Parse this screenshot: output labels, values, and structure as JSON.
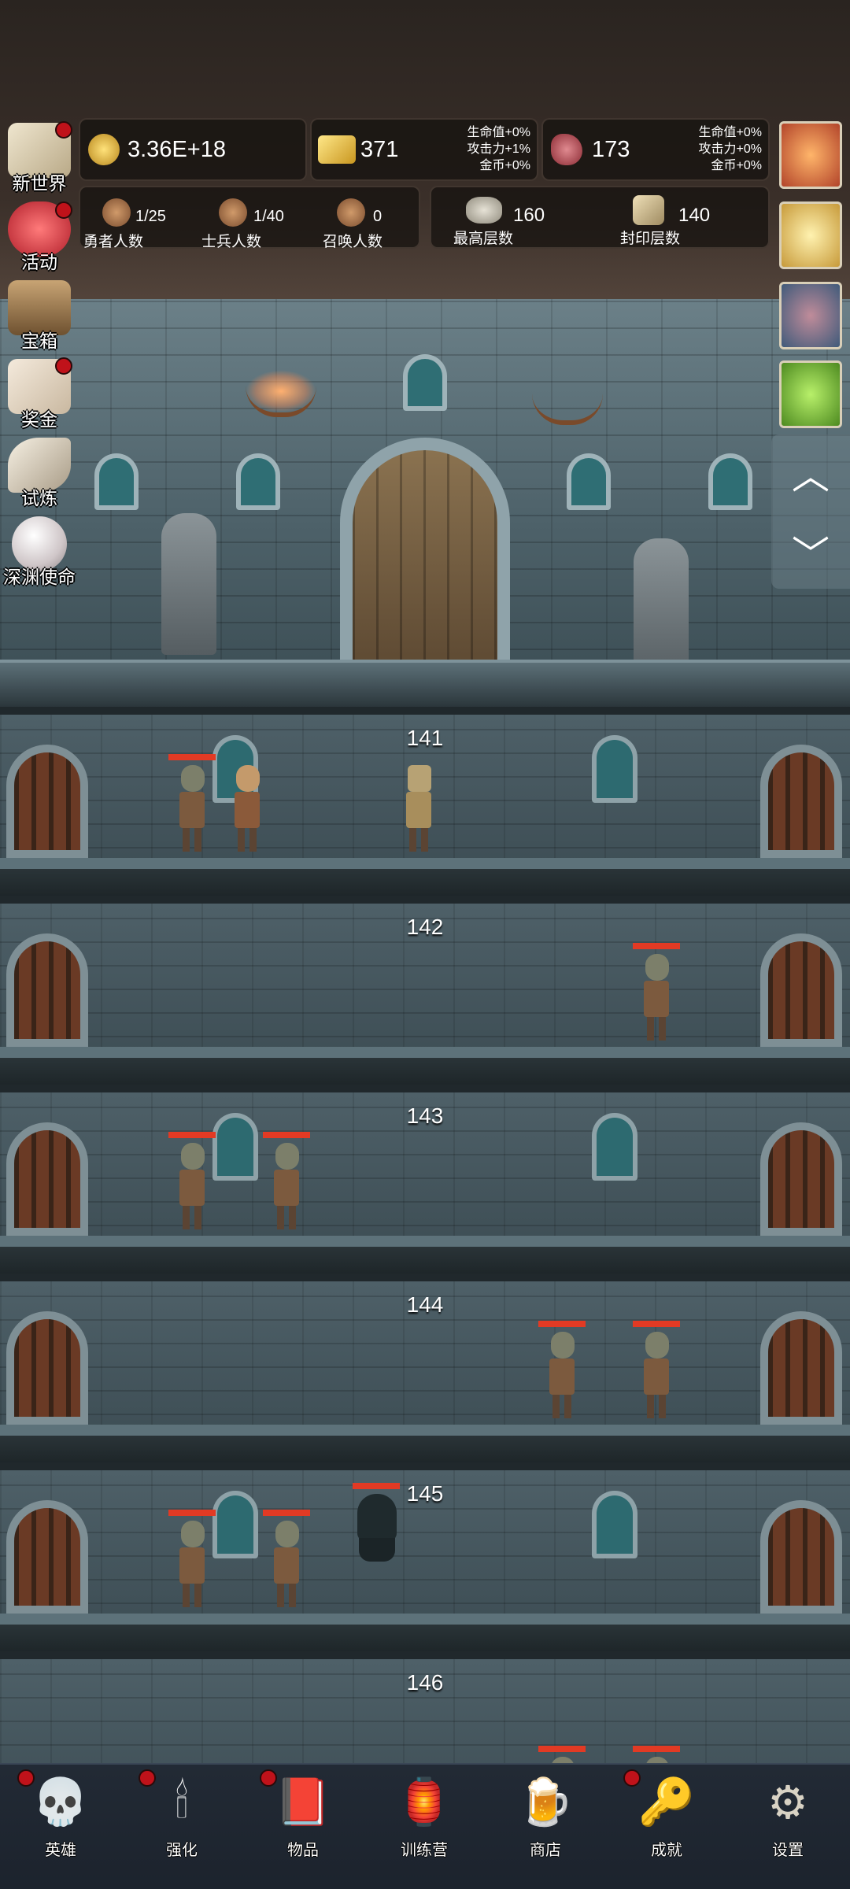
{
  "resources": {
    "gold": {
      "icon": "gold-coin-icon",
      "value": "3.36E+18"
    },
    "gold_bar": {
      "icon": "gold-bar-icon",
      "value": "371",
      "bonus": [
        "生命值+0%",
        "攻击力+1%",
        "金币+0%"
      ]
    },
    "meat": {
      "icon": "meat-icon",
      "value": "173",
      "bonus": [
        "生命值+0%",
        "攻击力+0%",
        "金币+0%"
      ]
    }
  },
  "counts": [
    {
      "value": "1/25",
      "label": "勇者人数"
    },
    {
      "value": "1/40",
      "label": "士兵人数"
    },
    {
      "value": "0",
      "label": "召唤人数"
    }
  ],
  "floors_info": [
    {
      "value": "160",
      "label": "最高层数"
    },
    {
      "value": "140",
      "label": "封印层数"
    }
  ],
  "side_menu": [
    {
      "label": "新世界",
      "icon": "scroll-map-icon",
      "dot": true
    },
    {
      "label": "活动",
      "icon": "heart-icon",
      "dot": true
    },
    {
      "label": "宝箱",
      "icon": "treasure-chest-icon",
      "dot": false
    },
    {
      "label": "奖金",
      "icon": "envelope-icon",
      "dot": true
    },
    {
      "label": "试炼",
      "icon": "feather-icon",
      "dot": false
    },
    {
      "label": "深渊使命",
      "icon": "pearl-icon",
      "dot": false
    }
  ],
  "right_items": [
    {
      "icon": "fruit-item-icon"
    },
    {
      "icon": "candle-item-icon"
    },
    {
      "icon": "gem-item-icon"
    },
    {
      "icon": "slime-item-icon"
    }
  ],
  "scroll": {
    "up": "︿",
    "down": "﹀"
  },
  "floors": [
    {
      "number": "141"
    },
    {
      "number": "142"
    },
    {
      "number": "143"
    },
    {
      "number": "144"
    },
    {
      "number": "145"
    },
    {
      "number": "146"
    }
  ],
  "bottom_nav": [
    {
      "label": "英雄",
      "icon": "skull-icon",
      "glyph": "💀",
      "dot": true
    },
    {
      "label": "强化",
      "icon": "candle-icon",
      "glyph": "🕯",
      "dot": true
    },
    {
      "label": "物品",
      "icon": "book-icon",
      "glyph": "📕",
      "dot": true
    },
    {
      "label": "训练营",
      "icon": "lantern-icon",
      "glyph": "🏮",
      "dot": false
    },
    {
      "label": "商店",
      "icon": "beer-mug-icon",
      "glyph": "🍺",
      "dot": false
    },
    {
      "label": "成就",
      "icon": "key-icon",
      "glyph": "🔑",
      "dot": true
    },
    {
      "label": "设置",
      "icon": "gear-icon",
      "glyph": "⚙",
      "dot": false
    }
  ]
}
